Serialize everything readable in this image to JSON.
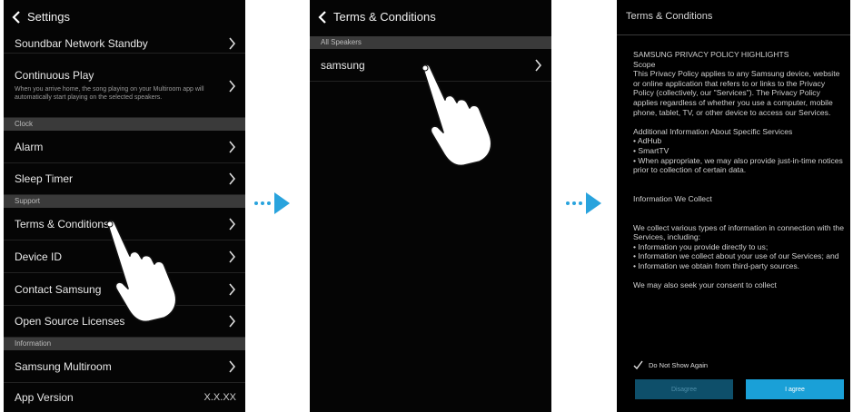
{
  "screen1": {
    "title": "Settings",
    "rows": [
      {
        "label": "Soundbar Network Standby"
      },
      {
        "label": "Continuous Play",
        "description": "When you arrive home, the song playing on your Multiroom app will automatically start playing on the selected speakers."
      }
    ],
    "section_clock": "Clock",
    "alarm": "Alarm",
    "sleep_timer": "Sleep Timer",
    "section_support": "Support",
    "terms": "Terms & Conditions",
    "device_id": "Device ID",
    "contact": "Contact Samsung",
    "open_source": "Open Source Licenses",
    "section_information": "Information",
    "samsung_multiroom": "Samsung Multiroom",
    "app_version_label": "App Version",
    "app_version_value": "X.X.XX"
  },
  "screen2": {
    "title": "Terms & Conditions",
    "section": "All Speakers",
    "item": "samsung"
  },
  "screen3": {
    "title": "Terms & Conditions",
    "policy_text": "SAMSUNG PRIVACY POLICY HIGHLIGHTS\nScope\nThis Privacy Policy applies to any Samsung device, website or online application that refers to or links to the Privacy Policy (collectively, our \"Services\"). The Privacy Policy applies regardless of whether you use a computer, mobile phone, tablet, TV, or other device to access our Services.\n\nAdditional Information About Specific Services\n• AdHub\n• SmartTV\n• When appropriate, we may also provide just-in-time notices prior to collection of certain data.\n\n\nInformation We Collect\n\n\nWe collect various types of information in connection with the Services, including:\n• Information you provide directly to us;\n• Information we collect about your use of our Services; and\n• Information we obtain from third-party sources.\n\nWe may also seek your consent to collect",
    "checkbox_label": "Do Not Show Again",
    "disagree": "Disagree",
    "agree": "I agree"
  },
  "colors": {
    "accent": "#1aa0d7",
    "section": "#3a3a3a"
  }
}
